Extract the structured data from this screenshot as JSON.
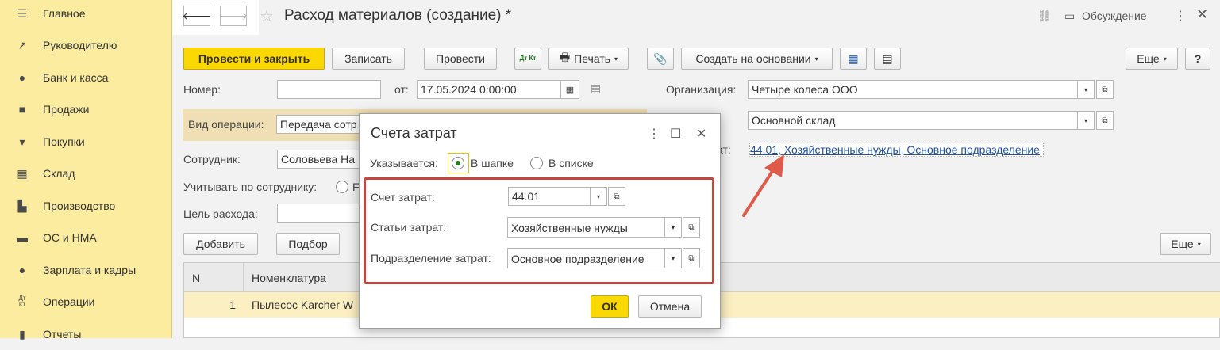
{
  "sidebar": {
    "items": [
      {
        "label": "Главное",
        "icon": "menu-icon"
      },
      {
        "label": "Руководителю",
        "icon": "trend-icon"
      },
      {
        "label": "Банк и касса",
        "icon": "coin-icon"
      },
      {
        "label": "Продажи",
        "icon": "bag-icon"
      },
      {
        "label": "Покупки",
        "icon": "cart-icon"
      },
      {
        "label": "Склад",
        "icon": "warehouse-icon"
      },
      {
        "label": "Производство",
        "icon": "factory-icon"
      },
      {
        "label": "ОС и НМА",
        "icon": "truck-icon"
      },
      {
        "label": "Зарплата и кадры",
        "icon": "person-icon"
      },
      {
        "label": "Операции",
        "icon": "dt-kt-icon"
      },
      {
        "label": "Отчеты",
        "icon": "bar-chart-icon"
      }
    ]
  },
  "header": {
    "title": "Расход материалов (создание) *",
    "discussion": "Обсуждение"
  },
  "toolbar": {
    "post_close": "Провести и закрыть",
    "save": "Записать",
    "post": "Провести",
    "dtkt": "Дт Кт",
    "print": "Печать",
    "create_based": "Создать на основании",
    "more": "Еще",
    "help": "?"
  },
  "form": {
    "number_label": "Номер:",
    "number_value": "",
    "date_label": "от:",
    "date_value": "17.05.2024  0:00:00",
    "org_label": "Организация:",
    "org_value": "Четыре колеса ООО",
    "optype_label": "Вид операции:",
    "optype_value": "Передача сотр",
    "warehouse_value": "Основной склад",
    "employee_label": "Сотрудник:",
    "employee_value": "Соловьева На",
    "account_by_employee_label": "Учитывать по сотруднику:",
    "account_by_employee_tail": "F",
    "cost_label_tail": "ат:",
    "cost_link": "44.01, Хозяйственные нужды, Основное подразделение",
    "purpose_label": "Цель расхода:",
    "purpose_value": ""
  },
  "table_toolbar": {
    "add": "Добавить",
    "pick": "Подбор",
    "more": "Еще"
  },
  "table": {
    "headers": [
      "N",
      "Номенклатура"
    ],
    "rows": [
      {
        "n": "1",
        "item": "Пылесос Karcher W"
      }
    ]
  },
  "dialog": {
    "title": "Счета затрат",
    "specified_label": "Указывается:",
    "opt_header": "В шапке",
    "opt_list": "В списке",
    "account_label": "Счет затрат:",
    "account_value": "44.01",
    "items_label": "Статьи затрат:",
    "items_value": "Хозяйственные нужды",
    "dept_label": "Подразделение затрат:",
    "dept_value": "Основное подразделение",
    "ok": "ОК",
    "cancel": "Отмена"
  },
  "colors": {
    "accent": "#fbd800",
    "sidebar": "#fbeca0",
    "highlight": "#c3463e",
    "link": "#1f52a3"
  }
}
